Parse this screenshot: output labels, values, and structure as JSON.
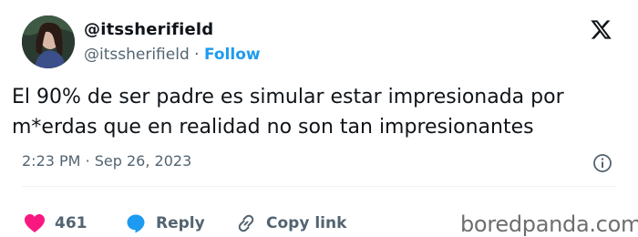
{
  "author": {
    "display_name": "@itssherifield",
    "handle": "@itssherifield",
    "separator": "·",
    "follow_label": "Follow"
  },
  "tweet": {
    "text": "El 90% de ser padre es simular estar impresionada por\nm*erdas que en realidad no son tan impresionantes"
  },
  "meta": {
    "time": "2:23 PM",
    "separator": "·",
    "date": "Sep 26, 2023"
  },
  "actions": {
    "likes_count": "461",
    "reply_label": "Reply",
    "copy_label": "Copy link"
  },
  "watermark": "boredpanda.com",
  "icons": {
    "brand": "x-logo-icon",
    "info": "info-icon",
    "like": "heart-icon",
    "reply": "reply-bubble-icon",
    "copy": "link-icon"
  },
  "colors": {
    "accent": "#1d9bf0",
    "like": "#f91880",
    "muted_text": "#536471",
    "text": "#0f1419"
  }
}
